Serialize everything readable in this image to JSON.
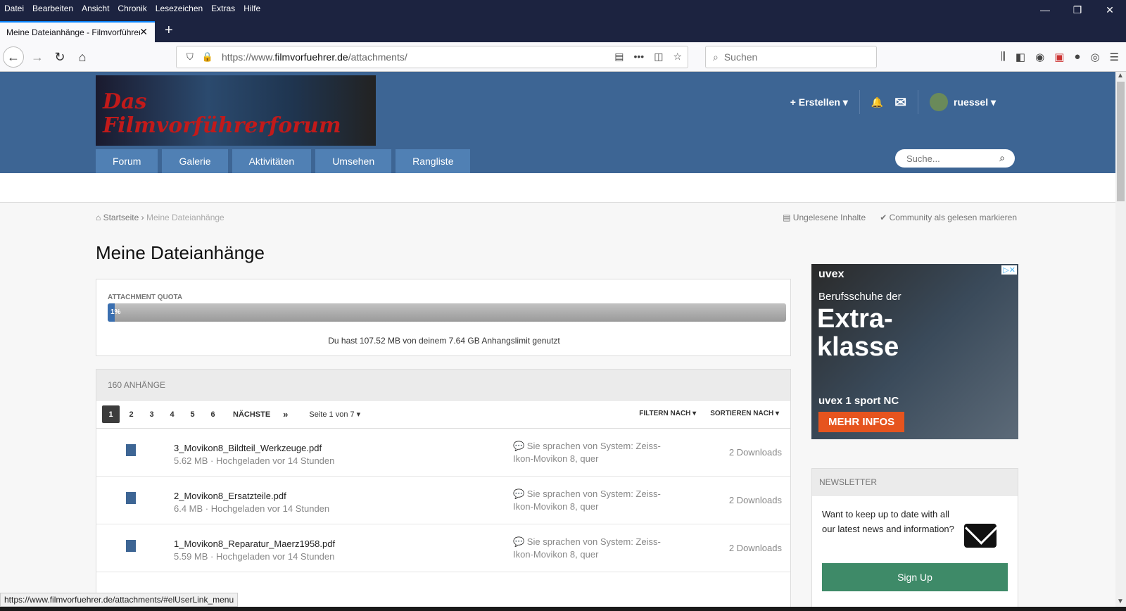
{
  "menubar": {
    "items": [
      "Datei",
      "Bearbeiten",
      "Ansicht",
      "Chronik",
      "Lesezeichen",
      "Extras",
      "Hilfe"
    ]
  },
  "window": {
    "minimize": "—",
    "restore": "❐",
    "close": "✕"
  },
  "tab": {
    "title": "Meine Dateianhänge - Filmvorführer",
    "close": "✕",
    "new": "+"
  },
  "navbar": {
    "url_prefix": "https://www.",
    "url_domain": "filmvorfuehrer.de",
    "url_path": "/attachments/",
    "search_placeholder": "Suchen",
    "more": "•••"
  },
  "logo": {
    "line1": "Das",
    "line2": "Filmvorführerforum"
  },
  "user": {
    "create": "+ Erstellen ▾",
    "bell": "🔔",
    "mail": "✉",
    "name": "ruessel ▾"
  },
  "mainnav": {
    "items": [
      "Forum",
      "Galerie",
      "Aktivitäten",
      "Umsehen",
      "Rangliste"
    ]
  },
  "header_search": {
    "placeholder": "Suche..."
  },
  "breadcrumb": {
    "home": "Startseite",
    "sep": "›",
    "current": "Meine Dateianhänge"
  },
  "rightlinks": {
    "unread": "Ungelesene Inhalte",
    "mark": "Community als gelesen markieren"
  },
  "page_title": "Meine Dateianhänge",
  "quota": {
    "label": "ATTACHMENT QUOTA",
    "percent": 0.01,
    "percent_label": "1%",
    "text": "Du hast 107.52 MB von deinem 7.64 GB Anhangslimit genutzt"
  },
  "list": {
    "header": "160 ANHÄNGE",
    "pages": [
      "1",
      "2",
      "3",
      "4",
      "5",
      "6"
    ],
    "next": "NÄCHSTE",
    "last": "»",
    "page_info": "Seite 1 von 7 ▾",
    "filter": "FILTERN NACH ▾",
    "sort": "SORTIEREN NACH ▾",
    "rows": [
      {
        "name": "3_Movikon8_Bildteil_Werkzeuge.pdf",
        "meta": "5.62 MB · Hochgeladen vor 14 Stunden",
        "context": "💬 Sie sprachen von System: Zeiss-Ikon-Movikon 8, quer",
        "downloads": "2 Downloads"
      },
      {
        "name": "2_Movikon8_Ersatzteile.pdf",
        "meta": "6.4 MB · Hochgeladen vor 14 Stunden",
        "context": "💬 Sie sprachen von System: Zeiss-Ikon-Movikon 8, quer",
        "downloads": "2 Downloads"
      },
      {
        "name": "1_Movikon8_Reparatur_Maerz1958.pdf",
        "meta": "5.59 MB · Hochgeladen vor 14 Stunden",
        "context": "💬 Sie sprachen von System: Zeiss-Ikon-Movikon 8, quer",
        "downloads": "2 Downloads"
      }
    ]
  },
  "ad": {
    "brand": "uvex",
    "line1": "Berufsschuhe der",
    "line2": "Extra-",
    "line3": "klasse",
    "product": "uvex 1 sport NC",
    "cta": "MEHR INFOS",
    "adchoice": "▷✕"
  },
  "newsletter": {
    "header": "NEWSLETTER",
    "text": "Want to keep up to date with all our latest news and information?",
    "button": "Sign Up"
  },
  "status": {
    "url": "https://www.filmvorfuehrer.de/attachments/#elUserLink_menu"
  }
}
